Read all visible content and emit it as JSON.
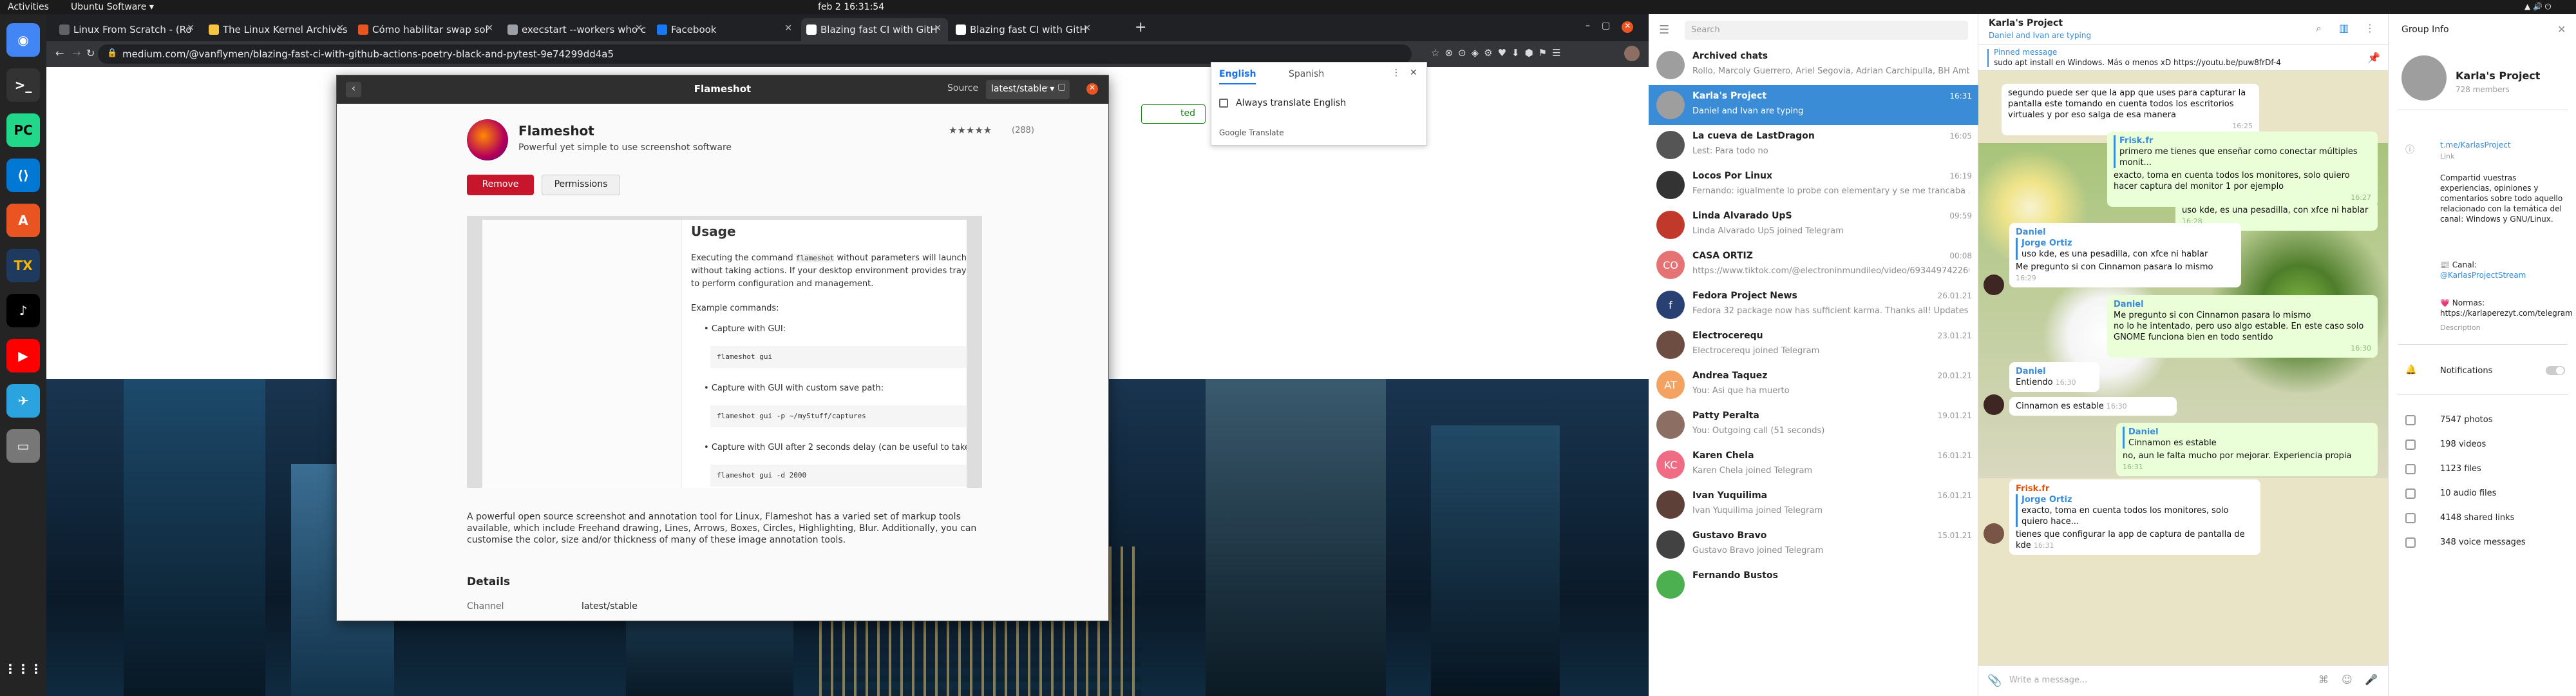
{
  "topbar": {
    "activities": "Activities",
    "app": "Ubuntu Software ▾",
    "clock": "feb 2  16:31:54"
  },
  "browser": {
    "tabs": [
      {
        "label": "Linux From Scratch - (Ro",
        "color": "#5f6368"
      },
      {
        "label": "The Linux Kernel Archives",
        "color": "#f5c542"
      },
      {
        "label": "Cómo habilitar swap sol",
        "color": "#e95420"
      },
      {
        "label": "execstart --workers who c",
        "color": "#9aa0a6"
      },
      {
        "label": "Facebook",
        "color": "#1877f2"
      },
      {
        "label": "Blazing fast CI with GitH",
        "color": "#ffffff"
      },
      {
        "label": "Blazing fast CI with GitH",
        "color": "#ffffff"
      }
    ],
    "url": "medium.com/@vanflymen/blazing-fast-ci-with-github-actions-poetry-black-and-pytest-9e74299dd4a5"
  },
  "flameshot": {
    "window_title": "Flameshot",
    "source_label": "Source",
    "source_value": "latest/stable",
    "app_name": "Flameshot",
    "tagline": "Powerful yet simple to use screenshot software",
    "rating_stars": "★★★★★",
    "rating_count": "(288)",
    "remove_label": "Remove",
    "permissions_label": "Permissions",
    "usage_title": "Usage",
    "usage_intro_a": "Executing the command",
    "usage_cmd": "flameshot",
    "usage_intro_b": "without parameters will launch a r",
    "usage_intro_c": "without taking actions. If your desktop environment provides tray area, a",
    "usage_intro_d": "to perform configuration and management.",
    "example_label": "Example commands:",
    "ex1": "Capture with GUI:",
    "ex1_code": "flameshot gui",
    "ex2": "Capture with GUI with custom save path:",
    "ex2_code": "flameshot gui -p ~/myStuff/captures",
    "ex3": "Capture with GUI after 2 seconds delay (can be useful to take scree",
    "ex3_code": "flameshot gui -d 2000",
    "description": "A powerful open source screenshot and annotation tool for Linux, Flameshot has a varied set of markup tools available, which include Freehand drawing, Lines, Arrows, Boxes, Circles, Highlighting, Blur. Additionally, you can customise the color, size and/or thickness of many of these image annotation tools.",
    "details_title": "Details",
    "channel_label": "Channel",
    "channel_value": "latest/stable"
  },
  "translate": {
    "tab_en": "English",
    "tab_es": "Spanish",
    "always": "Always translate English",
    "brand": "Google Translate"
  },
  "medium_side": {
    "button": "ted"
  },
  "telegram": {
    "search_placeholder": "Search",
    "chats": [
      {
        "name": "Archived chats",
        "time": "",
        "preview": "Rollo, Marcoly Guerrero, Ariel Segovia, Adrian Carchipulla, BH Ambist...",
        "avatar": "",
        "color": "#9e9e9e"
      },
      {
        "name": "Karla's Project",
        "time": "16:31",
        "preview": "Daniel and Ivan are typing",
        "avatar": "",
        "color": "#9e9e9e"
      },
      {
        "name": "La cueva de LastDragon",
        "time": "16:05",
        "preview": "Lest: Para todo no",
        "avatar": "",
        "color": "#555"
      },
      {
        "name": "Locos Por Linux",
        "time": "16:19",
        "preview": "Fernando: igualmente lo probe con elementary y se me trancaba ...",
        "avatar": "",
        "color": "#333"
      },
      {
        "name": "Linda Alvarado UpS",
        "time": "09:59",
        "preview": "Linda Alvarado UpS joined Telegram",
        "avatar": "",
        "color": "#c0392b"
      },
      {
        "name": "CASA ORTIZ",
        "time": "00:08",
        "preview": "https://www.tiktok.com/@electroninmundileo/video/693449742260891930...",
        "avatar": "CO",
        "color": "#e57373"
      },
      {
        "name": "Fedora Project News",
        "time": "26.01.21",
        "preview": "Fedora 32 package now has sufficient karma. Thanks all! Updates fo...",
        "avatar": "f",
        "color": "#294172"
      },
      {
        "name": "Electrocerequ",
        "time": "23.01.21",
        "preview": "Electrocerequ joined Telegram",
        "avatar": "",
        "color": "#6d4c41"
      },
      {
        "name": "Andrea Taquez",
        "time": "20.01.21",
        "preview": "You: Asi que ha muerto",
        "avatar": "AT",
        "color": "#f4a261"
      },
      {
        "name": "Patty Peralta",
        "time": "19.01.21",
        "preview": "You: Outgoing call (51 seconds)",
        "avatar": "",
        "color": "#8d6e63"
      },
      {
        "name": "Karen Chela",
        "time": "16.01.21",
        "preview": "Karen Chela joined Telegram",
        "avatar": "KC",
        "color": "#ef6c84"
      },
      {
        "name": "Ivan Yuquilima",
        "time": "16.01.21",
        "preview": "Ivan Yuquilima joined Telegram",
        "avatar": "",
        "color": "#5d4037"
      },
      {
        "name": "Gustavo Bravo",
        "time": "15.01.21",
        "preview": "Gustavo Bravo joined Telegram",
        "avatar": "",
        "color": "#424242"
      },
      {
        "name": "Fernando Bustos",
        "time": "",
        "preview": "",
        "avatar": "",
        "color": "#4caf50"
      }
    ],
    "chat_title": "Karla's Project",
    "chat_status": "Daniel and Ivan are typing",
    "pinned_label": "Pinned message",
    "pinned_text": "sudo apt install en Windows. Más o menos xD  https://youtu.be/puw8frDf-4",
    "messages": [
      {
        "author": "",
        "text": "segundo puede ser que la app que uses para capturar la pantalla este tomando en cuenta todos los escritorios virtuales y por eso salga de esa manera",
        "time": "16:25"
      },
      {
        "author": "Frisk.fr",
        "quote": "primero me tienes que enseñar como conectar múltiples monit...",
        "text": "exacto, toma en cuenta todos los monitores, solo quiero hacer captura del monitor 1 por ejemplo",
        "time": "16:27"
      },
      {
        "author": "",
        "text": "uso kde, es una pesadilla, con xfce ni hablar",
        "time": "16:28"
      },
      {
        "author": "Daniel",
        "quote_name": "Jorge Ortiz",
        "quote": "uso kde, es una pesadilla, con xfce ni hablar",
        "text": "Me pregunto si con Cinnamon pasara lo mismo",
        "time": "16:29"
      },
      {
        "author": "Daniel",
        "text": "Me pregunto si con Cinnamon pasara lo mismo",
        "text2": "no lo he intentado, pero uso algo estable. En este caso solo GNOME funciona bien en todo sentido",
        "time": "16:30"
      },
      {
        "author": "Daniel",
        "text": "Entiendo",
        "time": "16:30"
      },
      {
        "author": "",
        "text": "Cinnamon es estable",
        "time": "16:30"
      },
      {
        "author": "Daniel",
        "quote": "Cinnamon es estable",
        "text": "no, aun le falta mucho por mejorar. Experiencia propia",
        "time": "16:31"
      },
      {
        "author": "Frisk.fr",
        "quote_name": "Jorge Ortiz",
        "quote": "exacto, toma en cuenta todos los monitores, solo quiero hace...",
        "text": "tienes que configurar la app de captura de pantalla de kde",
        "time": "16:31"
      }
    ],
    "composer_placeholder": "Write a message...",
    "info": {
      "title": "Group Info",
      "name": "Karla's Project",
      "members": "728 members",
      "link": "t.me/KarlasProject",
      "link_label": "Link",
      "desc": "Compartid vuestras experiencias, opiniones y comentarios sobre todo aquello relacionado con la temática del canal: Windows y GNU/Linux.",
      "canal": "📰 Canal:",
      "canal_handle": "@KarlasProjectStream",
      "normas": "💗 Normas: https://karlaperezyt.com/telegram",
      "desc_label": "Description",
      "notifications": "Notifications",
      "stats": [
        "7547 photos",
        "198 videos",
        "1123 files",
        "10 audio files",
        "4148 shared links",
        "348 voice messages"
      ]
    }
  }
}
